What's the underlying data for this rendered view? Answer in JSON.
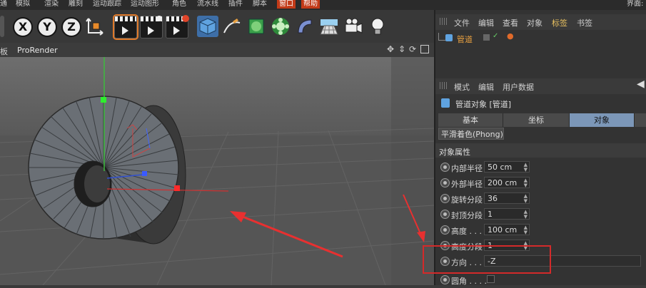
{
  "menubar": {
    "items": [
      "通",
      "模拟",
      "渲染",
      "雕刻",
      "运动跟踪",
      "运动图形",
      "角色",
      "流水线",
      "插件",
      "脚本",
      "窗口",
      "帮助"
    ],
    "right_label": "界面:"
  },
  "toolbar": {
    "axis_x": "X",
    "axis_y": "Y",
    "axis_z": "Z"
  },
  "viewport": {
    "menu_fragment": "板",
    "renderer": "ProRender"
  },
  "object_manager": {
    "menu": [
      "文件",
      "编辑",
      "查看",
      "对象",
      "标签",
      "书签"
    ],
    "object_name": "管道"
  },
  "attributes": {
    "menu": [
      "模式",
      "编辑",
      "用户数据"
    ],
    "title": "管道对象 [管道]",
    "tabs": [
      "基本",
      "坐标",
      "对象"
    ],
    "active_tab": "对象",
    "phong_tab": "平滑着色(Phong)",
    "section": "对象属性",
    "props": [
      {
        "label": "内部半径",
        "value": "50 cm"
      },
      {
        "label": "外部半径",
        "value": "200 cm"
      },
      {
        "label": "旋转分段",
        "value": "36"
      },
      {
        "label": "封顶分段",
        "value": "1"
      },
      {
        "label": "高度 . . . .",
        "value": "100 cm"
      },
      {
        "label": "高度分段",
        "value": "1"
      },
      {
        "label": "方向 . . . .",
        "value": "-Z"
      },
      {
        "label": "圆角 . . . .",
        "value": ""
      }
    ]
  },
  "colors": {
    "highlight_box": "#d42a2a",
    "active_tab": "#7c97b8",
    "selected_name": "#e8a040"
  }
}
